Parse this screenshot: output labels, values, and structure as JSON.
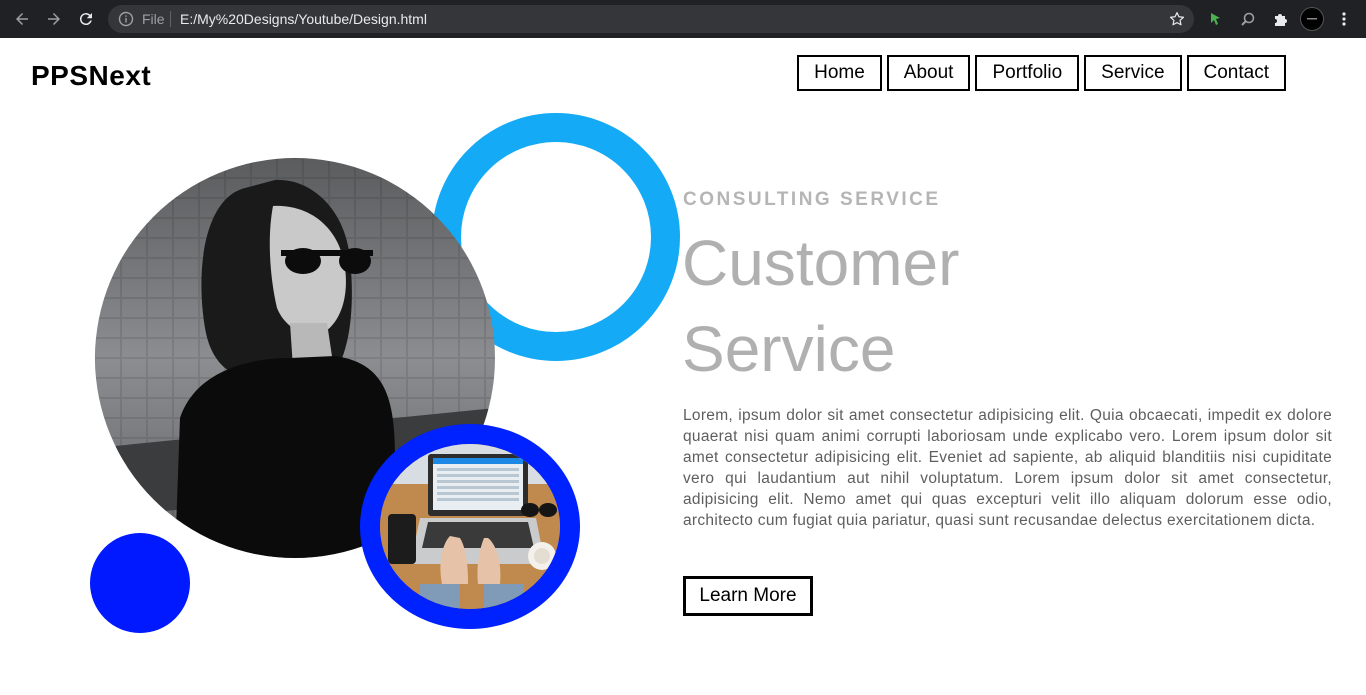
{
  "browser": {
    "scheme_label": "File",
    "url": "E:/My%20Designs/Youtube/Design.html"
  },
  "site": {
    "logo": "PPSNext",
    "nav": [
      "Home",
      "About",
      "Portfolio",
      "Service",
      "Contact"
    ]
  },
  "hero": {
    "eyebrow": "CONSULTING SERVICE",
    "headline": "Customer Service",
    "body": "Lorem, ipsum dolor sit amet consectetur adipisicing elit. Quia obcaecati, impedit ex dolore quaerat nisi quam animi corrupti laboriosam unde explicabo vero. Lorem ipsum dolor sit amet consectetur adipisicing elit. Eveniet ad sapiente, ab aliquid blanditiis nisi cupiditate vero qui laudantium aut nihil voluptatum. Lorem ipsum dolor sit amet consectetur, adipisicing elit. Nemo amet qui quas excepturi velit illo aliquam dolorum esse odio, architecto cum fugiat quia pariatur, quasi sunt recusandae delectus exercitationem dicta.",
    "cta": "Learn More"
  },
  "colors": {
    "ring_light_blue": "#14aaf5",
    "ring_dark_blue": "#0022ff",
    "dot_blue": "#0019ff",
    "heading_gray": "#b0b0b0"
  },
  "icons": [
    "back-icon",
    "forward-icon",
    "reload-icon",
    "info-icon",
    "star-icon",
    "extension-puzzle-icon",
    "menu-dots-icon"
  ]
}
